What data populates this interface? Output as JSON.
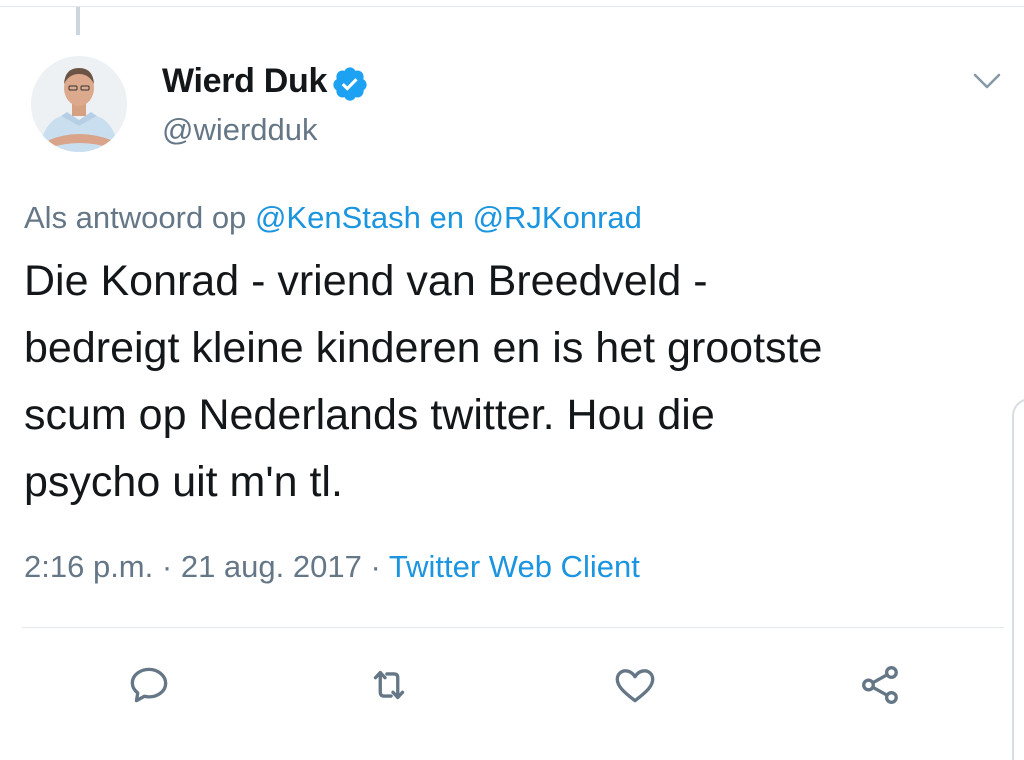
{
  "tweet": {
    "author": {
      "display_name": "Wierd Duk",
      "handle": "@wierdduk",
      "verified": true
    },
    "reply_context": {
      "prefix": "Als antwoord op",
      "mention_1": "@KenStash",
      "joiner": "en",
      "mention_2": "@RJKonrad"
    },
    "text_lines": [
      "Die Konrad - vriend van Breedveld -",
      "bedreigt kleine kinderen en is het grootste",
      "scum op Nederlands twitter. Hou die",
      "psycho uit m'n tl."
    ],
    "meta": {
      "time": "2:16 p.m.",
      "date": "21 aug. 2017",
      "separator": "·",
      "source": "Twitter Web Client"
    },
    "actions": [
      "reply-icon",
      "retweet-icon",
      "like-icon",
      "share-icon"
    ]
  },
  "colors": {
    "text": "#14171a",
    "secondary": "#657786",
    "link": "#1b95e0",
    "verified": "#1da1f2",
    "divider": "#e1e8ed"
  }
}
